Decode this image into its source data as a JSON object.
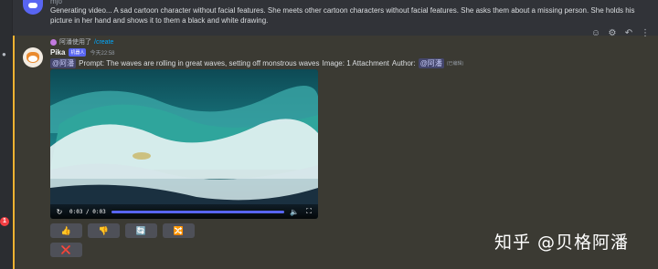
{
  "previous_message": {
    "author": "mjo",
    "text": "Generating video... A sad cartoon character without facial features. She meets other cartoon characters without facial features. She asks them about a missing person. She holds his picture in her hand and shows it to them a black and white drawing."
  },
  "reply": {
    "user": "阿潘使用了",
    "command": "/create"
  },
  "message": {
    "author": "Pika",
    "bot_tag": "机器人",
    "timestamp": "今天22:58",
    "mention_user": "@阿潘",
    "prompt": "Prompt: The waves are rolling in great waves, setting off monstrous waves",
    "image_info": "Image: 1 Attachment",
    "author_label": "Author:",
    "author_mention": "@阿潘",
    "edited": "(已编辑)"
  },
  "video": {
    "time": "0:03 / 0:03",
    "progress": 1.0
  },
  "buttons": {
    "row1": [
      {
        "name": "thumbs-up-button",
        "icon": "👍"
      },
      {
        "name": "thumbs-down-button",
        "icon": "👎"
      },
      {
        "name": "repeat-button",
        "icon": "🔄"
      },
      {
        "name": "shuffle-button",
        "icon": "🔀"
      }
    ],
    "row2": [
      {
        "name": "delete-button",
        "icon": "❌"
      }
    ]
  },
  "rail_badge": "1",
  "watermark": "知乎 @贝格阿潘",
  "colors": {
    "mention_bar": "#f0b232",
    "accent": "#5865f2",
    "background": "#313338"
  }
}
